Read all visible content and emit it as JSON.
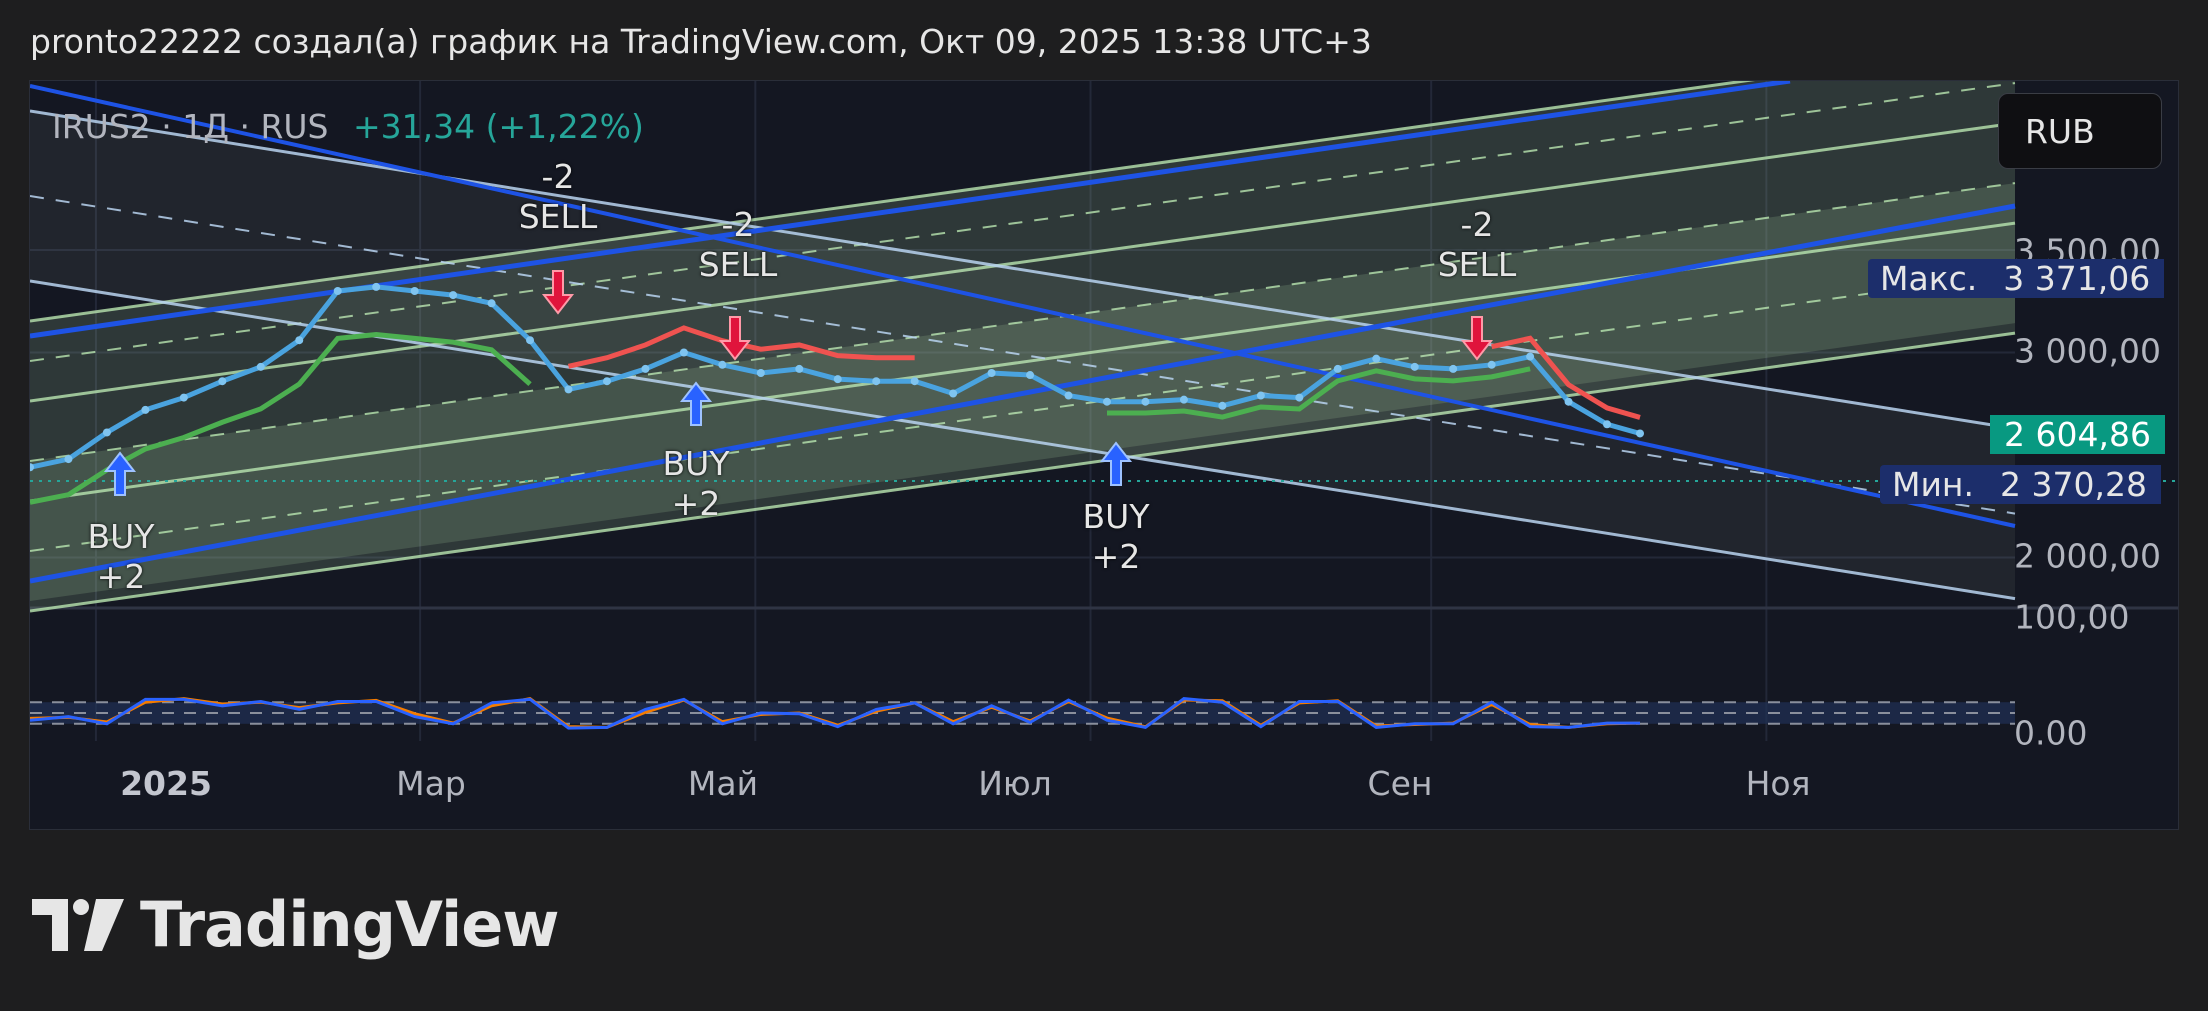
{
  "header": {
    "text": "pronto22222 создал(а) график на TradingView.com, Окт 09, 2025 13:38 UTC+3"
  },
  "legend": {
    "symbol": "IRUS2 · 1Д · RUS",
    "change": "+31,34 (+1,22%)"
  },
  "currency_button": {
    "label": "RUB"
  },
  "price_axis": {
    "labels": [
      "3 500,00",
      "3 000,00",
      "2 000,00"
    ]
  },
  "price_tags": {
    "max_label": "Макс.",
    "max_value": "3 371,06",
    "current_value": "2 604,86",
    "min_label": "Мин.",
    "min_value": "2 370,28"
  },
  "oscillator_axis": {
    "labels": [
      "100,00",
      "0.00"
    ]
  },
  "time_axis": {
    "labels": [
      "2025",
      "Мар",
      "Май",
      "Июл",
      "Сен",
      "Ноя"
    ]
  },
  "signals": [
    {
      "line1": "BUY",
      "line2": "+2"
    },
    {
      "line1": "-2",
      "line2": "SELL"
    },
    {
      "line1": "-2",
      "line2": "SELL"
    },
    {
      "line1": "BUY",
      "line2": "+2"
    },
    {
      "line1": "BUY",
      "line2": "+2"
    },
    {
      "line1": "-2",
      "line2": "SELL"
    }
  ],
  "logo": {
    "text": "TradingView"
  },
  "colors": {
    "up": "#26a69a",
    "price_line": "#4aa3df",
    "trail_bull": "#4caf50",
    "trail_bear": "#ef5350",
    "channel_fill": "#b9e6b0",
    "trendline": "#1e53e5",
    "stoch_k": "#2962ff",
    "stoch_d": "#f57c00"
  },
  "chart_data": {
    "type": "line",
    "title": "IRUS2 · 1Д · RUS",
    "x": [
      "2024-12-20",
      "2024-12-27",
      "2025-01-03",
      "2025-01-10",
      "2025-01-17",
      "2025-01-24",
      "2025-01-31",
      "2025-02-07",
      "2025-02-14",
      "2025-02-21",
      "2025-02-28",
      "2025-03-07",
      "2025-03-14",
      "2025-03-21",
      "2025-03-28",
      "2025-04-04",
      "2025-04-11",
      "2025-04-18",
      "2025-04-25",
      "2025-05-02",
      "2025-05-09",
      "2025-05-16",
      "2025-05-23",
      "2025-05-30",
      "2025-06-06",
      "2025-06-13",
      "2025-06-20",
      "2025-06-27",
      "2025-07-04",
      "2025-07-11",
      "2025-07-18",
      "2025-07-25",
      "2025-08-01",
      "2025-08-08",
      "2025-08-15",
      "2025-08-22",
      "2025-08-29",
      "2025-09-05",
      "2025-09-12",
      "2025-09-19",
      "2025-09-26",
      "2025-10-03",
      "2025-10-09"
    ],
    "series": [
      {
        "values": [
          2440,
          2480,
          2610,
          2720,
          2780,
          2860,
          2930,
          3060,
          3300,
          3320,
          3300,
          3280,
          3240,
          3060,
          2820,
          2860,
          2920,
          3000,
          2940,
          2900,
          2920,
          2870,
          2860,
          2860,
          2800,
          2900,
          2890,
          2790,
          2760,
          2760,
          2770,
          2740,
          2790,
          2780,
          2920,
          2970,
          2930,
          2920,
          2940,
          2980,
          2760,
          2650,
          2605
        ]
      }
    ],
    "oscillator": {
      "k": [
        30,
        40,
        20,
        88,
        88,
        70,
        82,
        60,
        82,
        82,
        40,
        20,
        78,
        88,
        8,
        10,
        60,
        88,
        20,
        50,
        48,
        12,
        60,
        78,
        20,
        70,
        24,
        86,
        30,
        10,
        90,
        80,
        12,
        82,
        82,
        10,
        20,
        20,
        80,
        12,
        10,
        22,
        22
      ],
      "d": [
        35,
        38,
        25,
        80,
        90,
        75,
        80,
        65,
        78,
        85,
        48,
        22,
        70,
        90,
        12,
        10,
        52,
        86,
        26,
        46,
        50,
        16,
        55,
        78,
        26,
        66,
        28,
        82,
        36,
        12,
        86,
        84,
        16,
        78,
        84,
        14,
        18,
        22,
        74,
        18,
        10,
        20,
        22
      ]
    },
    "ylim": [
      1750,
      3800
    ],
    "y_ticks": [
      3500,
      3000,
      2000
    ],
    "oscillator_ylim": [
      0,
      100
    ],
    "legend": "top-left",
    "grid": true
  }
}
